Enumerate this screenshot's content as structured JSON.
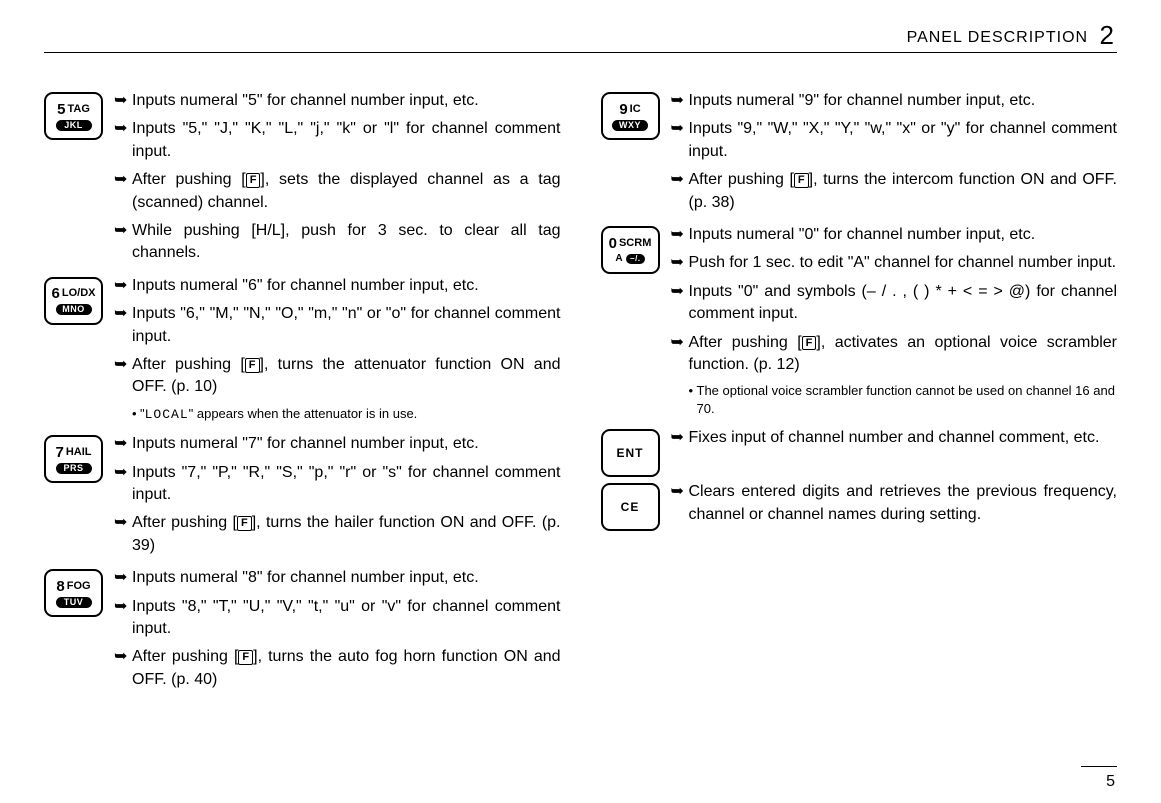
{
  "header": {
    "title": "PANEL DESCRIPTION",
    "section": "2"
  },
  "arrow": "➥",
  "inline_key": "F",
  "entries": [
    {
      "key": {
        "num": "5",
        "top": "TAG",
        "bottom": "JKL"
      },
      "items": [
        {
          "text": "Inputs numeral \"5\" for channel number input, etc."
        },
        {
          "text": "Inputs \"5,\" \"J,\" \"K,\" \"L,\" \"j,\" \"k\" or \"l\" for channel comment input."
        },
        {
          "pre": "After pushing [",
          "key": true,
          "post": "], sets the displayed channel as a tag (scanned) channel."
        },
        {
          "text": "While pushing [H/L], push for 3 sec. to clear all tag channels."
        }
      ]
    },
    {
      "key": {
        "num": "6",
        "top": "LO/DX",
        "bottom": "MNO"
      },
      "items": [
        {
          "text": "Inputs numeral \"6\" for channel number input, etc."
        },
        {
          "text": "Inputs \"6,\" \"M,\" \"N,\" \"O,\" \"m,\" \"n\" or \"o\" for channel comment input."
        },
        {
          "pre": "After pushing [",
          "key": true,
          "post": "], turns the attenuator function ON and OFF. (p. 10)"
        }
      ],
      "subs": [
        {
          "pre": "\"",
          "mono": "LOCAL",
          "post": "\" appears when the attenuator is in use."
        }
      ]
    },
    {
      "key": {
        "num": "7",
        "top": "HAIL",
        "bottom": "PRS"
      },
      "items": [
        {
          "text": "Inputs numeral \"7\" for channel number input, etc."
        },
        {
          "text": "Inputs \"7,\" \"P,\" \"R,\" \"S,\" \"p,\" \"r\" or \"s\" for channel comment input."
        },
        {
          "pre": "After pushing [",
          "key": true,
          "post": "], turns the hailer function ON and OFF. (p. 39)"
        }
      ]
    },
    {
      "key": {
        "num": "8",
        "top": "FOG",
        "bottom": "TUV"
      },
      "items": [
        {
          "text": "Inputs numeral \"8\" for channel number input, etc."
        },
        {
          "text": "Inputs \"8,\" \"T,\" \"U,\" \"V,\" \"t,\" \"u\" or \"v\" for channel comment input."
        },
        {
          "pre": "After pushing [",
          "key": true,
          "post": "], turns the auto fog horn function ON and OFF. (p. 40)"
        }
      ]
    },
    {
      "key": {
        "num": "9",
        "top": "IC",
        "bottom": "WXY"
      },
      "items": [
        {
          "text": "Inputs numeral \"9\" for channel number input, etc."
        },
        {
          "text": "Inputs \"9,\" \"W,\" \"X,\" \"Y,\" \"w,\" \"x\" or \"y\" for channel comment input."
        },
        {
          "pre": "After pushing [",
          "key": true,
          "post": "], turns the intercom function ON and OFF. (p. 38)"
        }
      ]
    },
    {
      "key": {
        "num": "0",
        "top": "SCRM",
        "bottom_left": "A",
        "bottom_right": "–/."
      },
      "items": [
        {
          "text": "Inputs numeral \"0\" for channel number input, etc."
        },
        {
          "text": "Push for 1 sec. to edit \"A\" channel for channel number input."
        },
        {
          "text": "Inputs \"0\" and symbols (– / . , ( ) * + < = > @) for channel comment input."
        },
        {
          "pre": "After pushing [",
          "key": true,
          "post": "], activates an optional voice scrambler function. (p. 12)"
        }
      ],
      "subs": [
        {
          "text": "The optional voice scrambler function cannot be used on channel 16 and 70."
        }
      ]
    },
    {
      "key": {
        "label": "ENT"
      },
      "items": [
        {
          "text": "Fixes input of channel number and channel comment, etc."
        }
      ]
    },
    {
      "key": {
        "label": "CE"
      },
      "items": [
        {
          "text": "Clears entered digits and retrieves the previous frequency, channel or channel names during setting."
        }
      ]
    }
  ],
  "page_number": "5"
}
